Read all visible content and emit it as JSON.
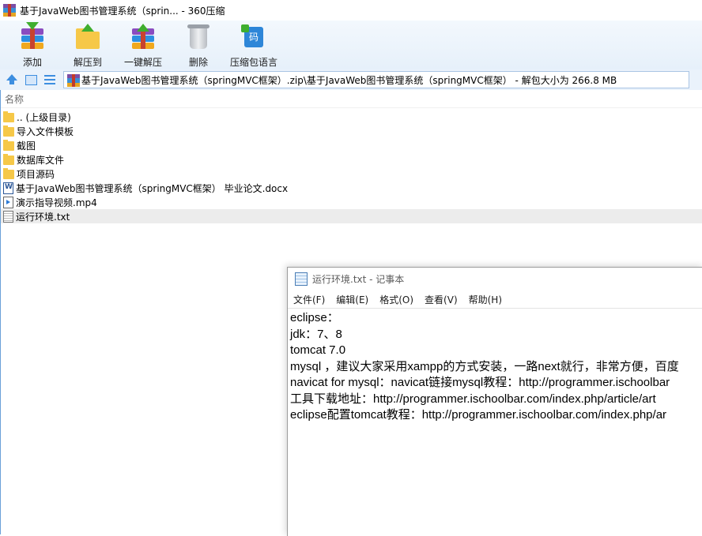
{
  "window": {
    "title": "基于JavaWeb图书管理系统（sprin... - 360压缩"
  },
  "toolbar": [
    {
      "label": "添加",
      "icon": "add-books-icon"
    },
    {
      "label": "解压到",
      "icon": "extract-to-icon"
    },
    {
      "label": "一键解压",
      "icon": "one-click-extract-icon"
    },
    {
      "label": "删除",
      "icon": "delete-bin-icon"
    },
    {
      "label": "压缩包语言",
      "icon": "archive-language-icon"
    }
  ],
  "navbar": {
    "path": "基于JavaWeb图书管理系统（springMVC框架）.zip\\基于JavaWeb图书管理系统（springMVC框架） - 解包大小为 266.8 MB"
  },
  "list": {
    "header_name": "名称",
    "items": [
      {
        "name": ".. (上级目录)",
        "type": "folder"
      },
      {
        "name": "导入文件模板",
        "type": "folder"
      },
      {
        "name": "截图",
        "type": "folder"
      },
      {
        "name": "数据库文件",
        "type": "folder"
      },
      {
        "name": "项目源码",
        "type": "folder"
      },
      {
        "name": "基于JavaWeb图书管理系统（springMVC框架） 毕业论文.docx",
        "type": "doc"
      },
      {
        "name": "演示指导视频.mp4",
        "type": "video"
      },
      {
        "name": "运行环境.txt",
        "type": "txt",
        "selected": true
      }
    ]
  },
  "notepad": {
    "title": "运行环境.txt - 记事本",
    "menu": [
      "文件(F)",
      "编辑(E)",
      "格式(O)",
      "查看(V)",
      "帮助(H)"
    ],
    "lines": [
      "eclipse：",
      "jdk：7、8",
      "tomcat 7.0",
      "mysql ，建议大家采用xampp的方式安装，一路next就行，非常方便，百度",
      "navicat for mysql：navicat链接mysql教程：http://programmer.ischoolbar",
      "工具下载地址：http://programmer.ischoolbar.com/index.php/article/art",
      "eclipse配置tomcat教程：http://programmer.ischoolbar.com/index.php/ar"
    ]
  }
}
